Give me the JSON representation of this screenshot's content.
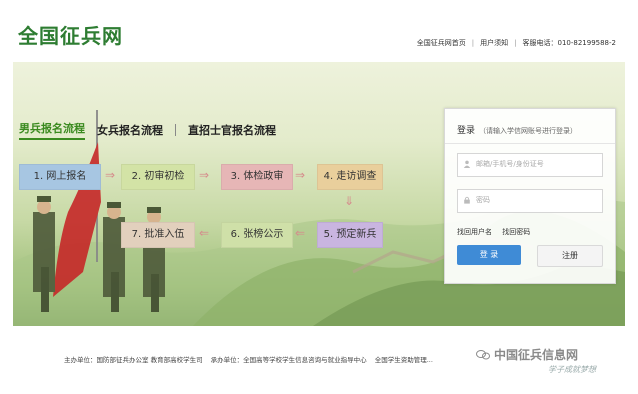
{
  "header": {
    "logo": "全国征兵网",
    "links": [
      "全国征兵网首页",
      "用户须知"
    ],
    "hotline": "客服电话：010-82199588-2"
  },
  "tabs": {
    "male": "男兵报名流程",
    "female": "女兵报名流程",
    "officer": "直招士官报名流程"
  },
  "steps": [
    {
      "label": "1. 网上报名",
      "color": "#a7c6e2"
    },
    {
      "label": "2. 初审初检",
      "color": "#d3e3a6"
    },
    {
      "label": "3. 体检政审",
      "color": "#e6b6b6"
    },
    {
      "label": "4. 走访调查",
      "color": "#e9cf9c"
    },
    {
      "label": "5. 预定新兵",
      "color": "#c9b5e0"
    },
    {
      "label": "6. 张榜公示",
      "color": "#cfe0a8"
    },
    {
      "label": "7. 批准入伍",
      "color": "#e2d0bd"
    }
  ],
  "login": {
    "title": "登录",
    "hint": "（请输入学信网账号进行登录）",
    "username_placeholder": "邮箱/手机号/身份证号",
    "password_placeholder": "密码",
    "forgot_user": "找回用户名",
    "forgot_pass": "找回密码",
    "login_btn": "登 录",
    "register_btn": "注册"
  },
  "footer": {
    "host": "主办单位：国防部征兵办公室  教育部高校学生司",
    "organizer": "承办单位：全国高等学校学生信息咨询与就业指导中心",
    "support": "全国学生资助管理...",
    "watermark": "中国征兵信息网",
    "watermark_script": "学子成就梦想"
  }
}
